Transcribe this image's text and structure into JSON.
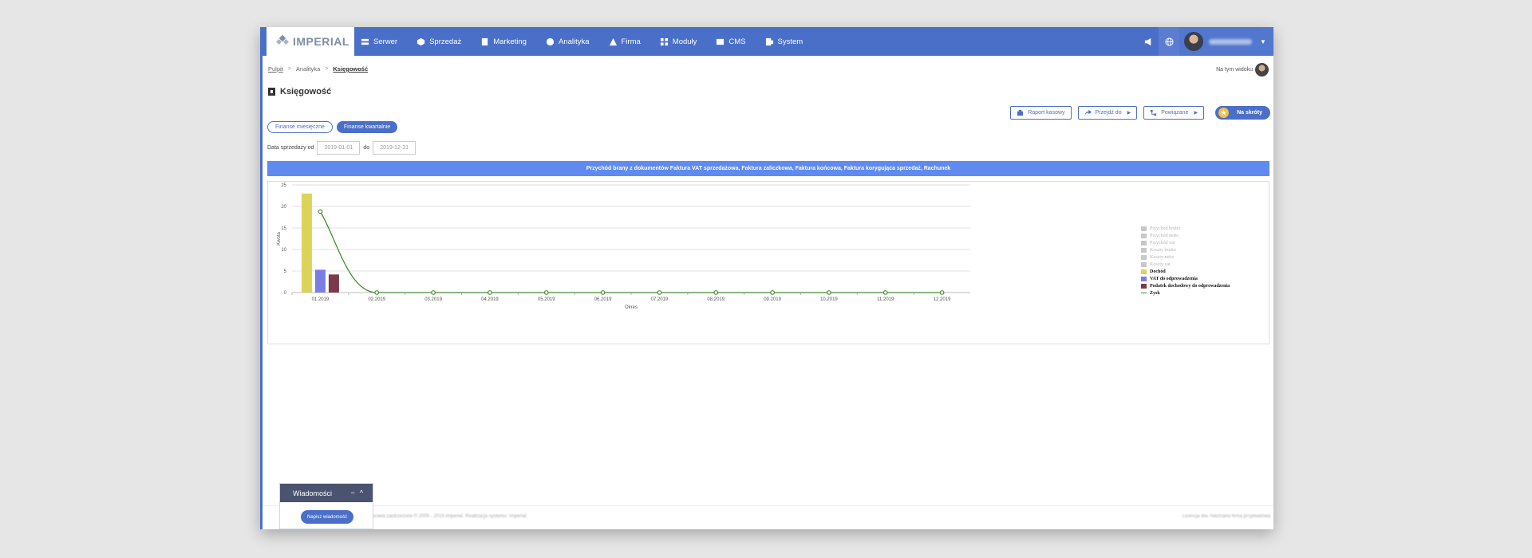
{
  "app": {
    "logo_text": "IMPERIAL",
    "nav": [
      {
        "label": "Serwer",
        "icon": "server-icon"
      },
      {
        "label": "Sprzedaż",
        "icon": "box-icon"
      },
      {
        "label": "Marketing",
        "icon": "marketing-icon"
      },
      {
        "label": "Analityka",
        "icon": "analytics-icon"
      },
      {
        "label": "Firma",
        "icon": "building-icon"
      },
      {
        "label": "Moduły",
        "icon": "modules-icon"
      },
      {
        "label": "CMS",
        "icon": "cms-icon"
      },
      {
        "label": "System",
        "icon": "system-icon"
      }
    ],
    "colors": {
      "primary": "#4a6fc9",
      "banner": "#5f8aef"
    }
  },
  "breadcrumb": {
    "items": [
      "Pulpit",
      "Analityka",
      "Księgowość"
    ],
    "separator": ">"
  },
  "view": {
    "label": "Na tym widoku"
  },
  "page": {
    "title": "Księgowość"
  },
  "actions": {
    "report": "Raport kasowy",
    "goto": "Przejdź do",
    "related": "Powiązane",
    "shortcuts": "Na skróty"
  },
  "tabs": {
    "monthly": "Finanse miesięczne",
    "quarterly": "Finanse kwartalnie"
  },
  "filter": {
    "label_from": "Data sprzedaży od",
    "from": "2019-01-01",
    "label_to": "do",
    "to": "2019-12-31"
  },
  "chart_banner": "Przychód brany z dokumentów Faktura VAT sprzedażowa, Faktura zaliczkowa, Faktura końcowa, Faktura korygująca sprzedaż, Rachunek",
  "chart_data": {
    "type": "bar",
    "categories": [
      "01.2019",
      "02.2019",
      "03.2019",
      "04.2019",
      "05.2019",
      "06.2019",
      "07.2019",
      "08.2019",
      "09.2019",
      "10.2019",
      "11.2019",
      "12.2019"
    ],
    "xlabel": "Okres",
    "ylabel": "Kwota",
    "ylim": [
      0,
      25
    ],
    "yticks": [
      0,
      5,
      10,
      15,
      20,
      25
    ],
    "grid": true,
    "legend_position": "right",
    "series": [
      {
        "name": "Przychód brutto",
        "type": "bar",
        "visible": false,
        "color": "#c8c8c8",
        "values": []
      },
      {
        "name": "Przychód netto",
        "type": "bar",
        "visible": false,
        "color": "#c8c8c8",
        "values": []
      },
      {
        "name": "Przychód vat",
        "type": "bar",
        "visible": false,
        "color": "#c8c8c8",
        "values": []
      },
      {
        "name": "Koszty brutto",
        "type": "bar",
        "visible": false,
        "color": "#c8c8c8",
        "values": []
      },
      {
        "name": "Koszty netto",
        "type": "bar",
        "visible": false,
        "color": "#c8c8c8",
        "values": []
      },
      {
        "name": "Koszty vat",
        "type": "bar",
        "visible": false,
        "color": "#c8c8c8",
        "values": []
      },
      {
        "name": "Dochód",
        "type": "bar",
        "visible": true,
        "color": "#dcd35a",
        "values": [
          23,
          0,
          0,
          0,
          0,
          0,
          0,
          0,
          0,
          0,
          0,
          0
        ]
      },
      {
        "name": "VAT do odprowadzenia",
        "type": "bar",
        "visible": true,
        "color": "#7b7de6",
        "values": [
          5.3,
          0,
          0,
          0,
          0,
          0,
          0,
          0,
          0,
          0,
          0,
          0
        ]
      },
      {
        "name": "Podatek dochodowy do odprowadzenia",
        "type": "bar",
        "visible": true,
        "color": "#7b3a4a",
        "values": [
          4.2,
          0,
          0,
          0,
          0,
          0,
          0,
          0,
          0,
          0,
          0,
          0
        ]
      },
      {
        "name": "Zysk",
        "type": "line",
        "visible": true,
        "color": "#3f8f2a",
        "values": [
          18.8,
          0,
          0,
          0,
          0,
          0,
          0,
          0,
          0,
          0,
          0,
          0
        ]
      }
    ]
  },
  "footer": {
    "left": "Wszelkie prawa zastrzeżone © 2005 - 2019 Imperial. Realizacja systemu: Imperial",
    "right": "Licencja dla: Nieznana firma przykładowa"
  },
  "messages": {
    "title": "Wiadomości",
    "minimize": "−",
    "collapse": "^",
    "write_button": "Napisz wiadomość"
  }
}
